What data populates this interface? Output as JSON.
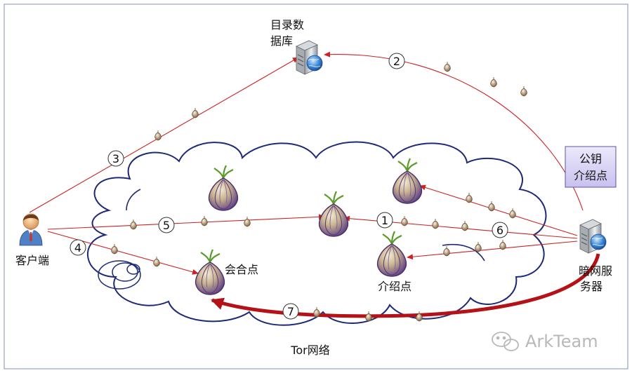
{
  "nodes": {
    "directory": {
      "line1": "目录数",
      "line2": "据库"
    },
    "client": {
      "label": "客户端"
    },
    "hidden_service": {
      "line1": "暗网服",
      "line2": "务器"
    },
    "rendezvous": {
      "label": "会合点"
    },
    "intro_point": {
      "label": "介绍点"
    }
  },
  "pubkey_box": {
    "line1": "公钥",
    "line2": "介绍点"
  },
  "network_label": "Tor网络",
  "steps": [
    "1",
    "2",
    "3",
    "4",
    "5",
    "6",
    "7"
  ],
  "watermark": "ArkTeam",
  "colors": {
    "cloud": "#1e2a78",
    "arrow": "#cc2222",
    "thick_arrow": "#b51218",
    "onion": "#6a4a8c",
    "box_fill": "#d9d4f2",
    "frame": "#7f8fb0"
  }
}
